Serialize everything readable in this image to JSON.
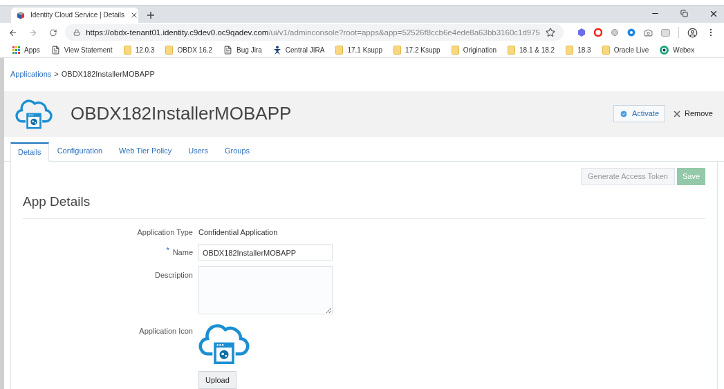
{
  "browser": {
    "tab_title": "Identity Cloud Service | Details",
    "url_host": "https://obdx-tenant01.identity.c9dev0.oc9qadev.com",
    "url_path": "/ui/v1/adminconsole?root=apps&app=52526f8ccb6e4ede8a63bb3160c1d975",
    "bookmarks": [
      {
        "kind": "apps",
        "label": "Apps"
      },
      {
        "kind": "page",
        "label": "View Statement"
      },
      {
        "kind": "folder",
        "label": "12.0.3"
      },
      {
        "kind": "folder",
        "label": "OBDX 16.2"
      },
      {
        "kind": "page",
        "label": "Bug Jira"
      },
      {
        "kind": "jira",
        "label": "Central JIRA"
      },
      {
        "kind": "folder",
        "label": "17.1 Ksupp"
      },
      {
        "kind": "folder",
        "label": "17.2 Ksupp"
      },
      {
        "kind": "folder",
        "label": "Origination"
      },
      {
        "kind": "folder",
        "label": "18.1 & 18.2"
      },
      {
        "kind": "folder",
        "label": "18.3"
      },
      {
        "kind": "folder",
        "label": "Oracle Live"
      },
      {
        "kind": "webex",
        "label": "Webex"
      }
    ]
  },
  "breadcrumb": {
    "link": "Applications",
    "separator": ">",
    "current": "OBDX182InstallerMOBAPP"
  },
  "header": {
    "title": "OBDX182InstallerMOBAPP",
    "activate": "Activate",
    "remove": "Remove"
  },
  "tabs": [
    {
      "label": "Details",
      "selected": true
    },
    {
      "label": "Configuration",
      "selected": false
    },
    {
      "label": "Web Tier Policy",
      "selected": false
    },
    {
      "label": "Users",
      "selected": false
    },
    {
      "label": "Groups",
      "selected": false
    }
  ],
  "actions": [
    {
      "label": "Generate Access Token",
      "kind": "secondary",
      "disabled": true
    },
    {
      "label": "Save",
      "kind": "primary",
      "disabled": true
    }
  ],
  "section_title": "App Details",
  "form": {
    "type_label": "Application Type",
    "type_value": "Confidential Application",
    "name_label": "Name",
    "required": "*",
    "name_value": "OBDX182InstallerMOBAPP",
    "description_label": "Description",
    "icon_label": "Application Icon",
    "upload": "Upload"
  }
}
